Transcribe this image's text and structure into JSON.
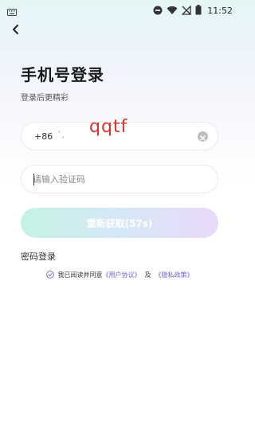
{
  "status_bar": {
    "time": "11:52",
    "icons": [
      "keyboard-icon",
      "do-not-disturb-icon",
      "wifi-icon",
      "no-sim-icon",
      "battery-icon"
    ]
  },
  "nav": {
    "back_icon": "chevron-left-icon"
  },
  "header": {
    "title": "手机号登录",
    "subtitle": "登录后更精彩"
  },
  "phone": {
    "prefix": "+86",
    "value": "`.",
    "overlay": "qqtf"
  },
  "code": {
    "placeholder": "请输入验证码"
  },
  "actions": {
    "resend_label": "重新获取(57s)",
    "password_login": "密码登录"
  },
  "agreement": {
    "prefix": "我已阅读并同意",
    "user_agreement": "《用户协议》",
    "and": "及",
    "privacy_policy": "《隐私政策》"
  },
  "colors": {
    "link": "#6b61e0",
    "overlay": "#d9342b",
    "button_gradient": [
      "#c3f3e4",
      "#d6e8f7",
      "#ebd9f8"
    ]
  }
}
